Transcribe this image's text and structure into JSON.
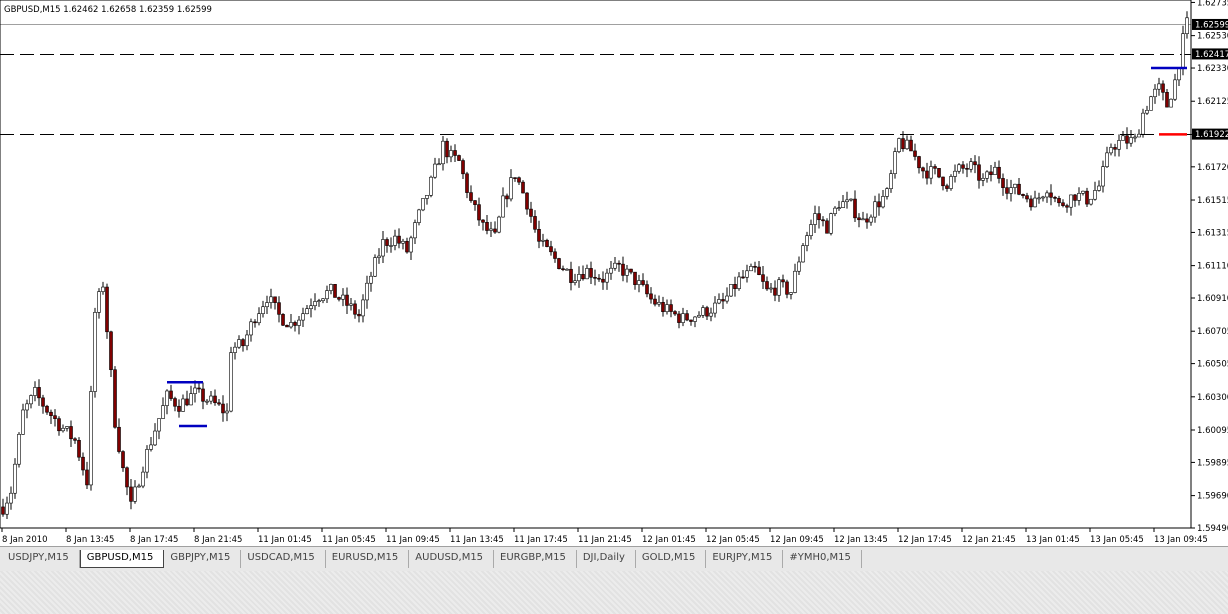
{
  "header": {
    "symbol_info": "GBPUSD,M15  1.62462 1.62658 1.62359 1.62599"
  },
  "colors": {
    "bull": "#ffffff",
    "bear": "#800000",
    "wick": "#000000",
    "hline": "#000000",
    "blue_marker": "#0000c0",
    "red_marker": "#ff0000"
  },
  "chart_data": {
    "type": "candlestick",
    "ylim": [
      1.5949,
      1.6275
    ],
    "y_ticks": [
      "1.62735",
      "1.62530",
      "1.62330",
      "1.62125",
      "1.61920",
      "1.61720",
      "1.61515",
      "1.61315",
      "1.61110",
      "1.60910",
      "1.60705",
      "1.60505",
      "1.60300",
      "1.60095",
      "1.59895",
      "1.59690",
      "1.59490"
    ],
    "x_ticks": [
      "8 Jan 2010",
      "8 Jan 13:45",
      "8 Jan 17:45",
      "8 Jan 21:45",
      "11 Jan 01:45",
      "11 Jan 05:45",
      "11 Jan 09:45",
      "11 Jan 13:45",
      "11 Jan 17:45",
      "11 Jan 21:45",
      "12 Jan 01:45",
      "12 Jan 05:45",
      "12 Jan 09:45",
      "12 Jan 13:45",
      "12 Jan 17:45",
      "12 Jan 21:45",
      "13 Jan 01:45",
      "13 Jan 05:45",
      "13 Jan 09:45"
    ],
    "price_labels": [
      {
        "text": "1.62599",
        "value": 1.62599
      },
      {
        "text": "1.62417",
        "value": 1.62417
      },
      {
        "text": "1.61922",
        "value": 1.61922
      }
    ],
    "horizontal_lines": [
      {
        "value": 1.62599,
        "style": "solid-gray"
      },
      {
        "value": 1.62417,
        "style": "dashed"
      },
      {
        "value": 1.61922,
        "style": "dashed"
      }
    ],
    "markers": [
      {
        "value": 1.6039,
        "color": "blue",
        "from_bar": 41,
        "to_bar": 50
      },
      {
        "value": 1.6012,
        "color": "blue",
        "from_bar": 44,
        "to_bar": 51
      },
      {
        "value": 1.6233,
        "color": "blue",
        "from_bar": 287,
        "to_bar": 296
      },
      {
        "value": 1.6192,
        "color": "red",
        "from_bar": 289,
        "to_bar": 296
      }
    ],
    "anchors": [
      [
        0,
        1.5962
      ],
      [
        2,
        1.5972
      ],
      [
        5,
        1.602
      ],
      [
        8,
        1.6032
      ],
      [
        11,
        1.6022
      ],
      [
        14,
        1.6013
      ],
      [
        18,
        1.6003
      ],
      [
        21,
        1.5978
      ],
      [
        23,
        1.6082
      ],
      [
        25,
        1.61
      ],
      [
        28,
        1.6015
      ],
      [
        30,
        1.5985
      ],
      [
        32,
        1.5962
      ],
      [
        35,
        1.5988
      ],
      [
        38,
        1.601
      ],
      [
        41,
        1.603
      ],
      [
        44,
        1.6025
      ],
      [
        48,
        1.6032
      ],
      [
        52,
        1.6027
      ],
      [
        56,
        1.602
      ],
      [
        57,
        1.606
      ],
      [
        60,
        1.6062
      ],
      [
        63,
        1.608
      ],
      [
        66,
        1.6092
      ],
      [
        69,
        1.608
      ],
      [
        72,
        1.6075
      ],
      [
        75,
        1.6082
      ],
      [
        78,
        1.6092
      ],
      [
        82,
        1.6095
      ],
      [
        86,
        1.6087
      ],
      [
        89,
        1.608
      ],
      [
        92,
        1.6105
      ],
      [
        95,
        1.6125
      ],
      [
        98,
        1.6128
      ],
      [
        101,
        1.612
      ],
      [
        104,
        1.6142
      ],
      [
        107,
        1.6162
      ],
      [
        110,
        1.6185
      ],
      [
        112,
        1.6178
      ],
      [
        114,
        1.6175
      ],
      [
        117,
        1.615
      ],
      [
        120,
        1.6135
      ],
      [
        123,
        1.6128
      ],
      [
        125,
        1.615
      ],
      [
        128,
        1.6168
      ],
      [
        131,
        1.615
      ],
      [
        134,
        1.6125
      ],
      [
        138,
        1.6115
      ],
      [
        142,
        1.6105
      ],
      [
        146,
        1.6108
      ],
      [
        150,
        1.6103
      ],
      [
        154,
        1.611
      ],
      [
        158,
        1.6102
      ],
      [
        162,
        1.609
      ],
      [
        166,
        1.6083
      ],
      [
        170,
        1.6078
      ],
      [
        175,
        1.6082
      ],
      [
        180,
        1.6088
      ],
      [
        184,
        1.6102
      ],
      [
        188,
        1.6108
      ],
      [
        191,
        1.6095
      ],
      [
        194,
        1.6098
      ],
      [
        197,
        1.6095
      ],
      [
        200,
        1.6125
      ],
      [
        203,
        1.6142
      ],
      [
        206,
        1.6135
      ],
      [
        209,
        1.615
      ],
      [
        212,
        1.6148
      ],
      [
        215,
        1.6138
      ],
      [
        218,
        1.6148
      ],
      [
        221,
        1.6155
      ],
      [
        224,
        1.6188
      ],
      [
        227,
        1.6182
      ],
      [
        230,
        1.617
      ],
      [
        233,
        1.6168
      ],
      [
        236,
        1.6162
      ],
      [
        239,
        1.617
      ],
      [
        242,
        1.6172
      ],
      [
        245,
        1.6163
      ],
      [
        248,
        1.617
      ],
      [
        251,
        1.616
      ],
      [
        255,
        1.6155
      ],
      [
        258,
        1.615
      ],
      [
        261,
        1.616
      ],
      [
        264,
        1.6148
      ],
      [
        268,
        1.6155
      ],
      [
        271,
        1.6152
      ],
      [
        274,
        1.616
      ],
      [
        277,
        1.6185
      ],
      [
        280,
        1.6188
      ],
      [
        283,
        1.6188
      ],
      [
        285,
        1.6205
      ],
      [
        287,
        1.6215
      ],
      [
        289,
        1.622
      ],
      [
        291,
        1.621
      ],
      [
        293,
        1.6225
      ],
      [
        295,
        1.625
      ],
      [
        296,
        1.626
      ]
    ]
  },
  "tabs": [
    "USDJPY,M15",
    "GBPUSD,M15",
    "GBPJPY,M15",
    "USDCAD,M15",
    "EURUSD,M15",
    "AUDUSD,M15",
    "EURGBP,M15",
    "DJI,Daily",
    "GOLD,M15",
    "EURJPY,M15",
    "#YMH0,M15"
  ],
  "active_tab": 1
}
